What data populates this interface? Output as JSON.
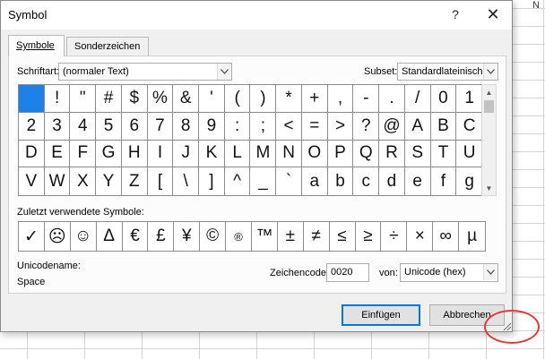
{
  "spreadsheet": {
    "column_header_partial": "N"
  },
  "window": {
    "title": "Symbol",
    "help": "?",
    "close": "✕"
  },
  "tabs": [
    {
      "label": "Symbole",
      "active": true
    },
    {
      "label": "Sonderzeichen",
      "active": false
    }
  ],
  "font": {
    "label": "Schriftart:",
    "value": "(normaler Text)"
  },
  "subset": {
    "label": "Subset:",
    "value": "Standardlateinisch"
  },
  "symbols": [
    " ",
    "!",
    "\"",
    "#",
    "$",
    "%",
    "&",
    "'",
    "(",
    ")",
    "*",
    "+",
    ",",
    "-",
    ".",
    "/",
    "0",
    "1",
    "2",
    "3",
    "4",
    "5",
    "6",
    "7",
    "8",
    "9",
    ":",
    ";",
    "<",
    "=",
    ">",
    "?",
    "@",
    "A",
    "B",
    "C",
    "D",
    "E",
    "F",
    "G",
    "H",
    "I",
    "J",
    "K",
    "L",
    "M",
    "N",
    "O",
    "P",
    "Q",
    "R",
    "S",
    "T",
    "U",
    "V",
    "W",
    "X",
    "Y",
    "Z",
    "[",
    "\\",
    "]",
    "^",
    "_",
    "`",
    "a",
    "b",
    "c",
    "d",
    "e",
    "f",
    "g"
  ],
  "recent": {
    "label": "Zuletzt verwendete Symbole:",
    "symbols": [
      "✓",
      "☹",
      "☺",
      "Δ",
      "€",
      "£",
      "¥",
      "©",
      "®",
      "™",
      "±",
      "≠",
      "≤",
      "≥",
      "÷",
      "×",
      "∞",
      "µ"
    ]
  },
  "unicode_name": {
    "label": "Unicodename:",
    "value": "Space"
  },
  "char_code": {
    "label": "Zeichencode:",
    "value": "0020"
  },
  "from": {
    "label": "von:",
    "value": "Unicode (hex)"
  },
  "buttons": {
    "insert": "Einfügen",
    "cancel": "Abbrechen"
  },
  "colors": {
    "selection": "#1e81e6",
    "highlight_oval": "#e03a3a",
    "default_button_border": "#0078d7"
  }
}
